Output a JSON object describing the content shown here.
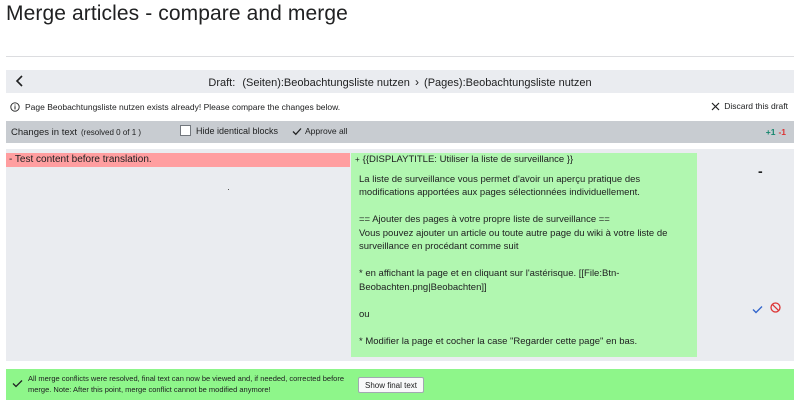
{
  "page": {
    "title": "Merge articles - compare and merge"
  },
  "draft_bar": {
    "label": "Draft:",
    "source": "(Seiten):Beobachtungsliste nutzen",
    "separator": "›",
    "target": "(Pages):Beobachtungsliste nutzen"
  },
  "notice": {
    "text": "Page Beobachtungsliste nutzen exists already! Please compare the changes below.",
    "discard_label": "Discard this draft"
  },
  "changes_bar": {
    "title": "Changes in text",
    "resolved": "(resolved 0 of 1 )",
    "hide_identical_label": "Hide identical blocks",
    "approve_all_label": "Approve all",
    "added": "+1",
    "removed": "-1"
  },
  "diff": {
    "left_line": "- Test content before translation.",
    "right_first_prefix": "+",
    "right_first_line": "{{DISPLAYTITLE:  Utiliser la liste de surveillance  }}",
    "right_body": "La liste de surveillance vous permet d'avoir un aperçu pratique des modifications apportées aux pages sélectionnées individuellement.\n\n== Ajouter des pages à votre propre liste de surveillance ==\nVous pouvez ajouter un article ou toute autre page du wiki à votre liste de surveillance en procédant comme suit\n\n* en affichant la page et en cliquant sur l'astérisque. [[File:Btn-Beobachten.png|Beobachten]]\n\nou\n\n* Modifier la page et cocher la case \"Regarder cette page\" en bas.",
    "side_marker": "-"
  },
  "success": {
    "message": "All merge conflicts were resolved, final text can now be viewed and, if needed, corrected before merge. Note: After this point, merge conflict cannot be modified anymore!",
    "button_label": "Show final text"
  },
  "colors": {
    "removed_bg": "#ff9ea0",
    "added_bg": "#b1f7b0",
    "success_bg": "#8ef68a",
    "accept": "#36c",
    "reject": "#d33"
  },
  "icons": [
    "back-arrow-icon",
    "info-icon",
    "close-icon",
    "check-icon",
    "accept-icon",
    "reject-icon"
  ]
}
